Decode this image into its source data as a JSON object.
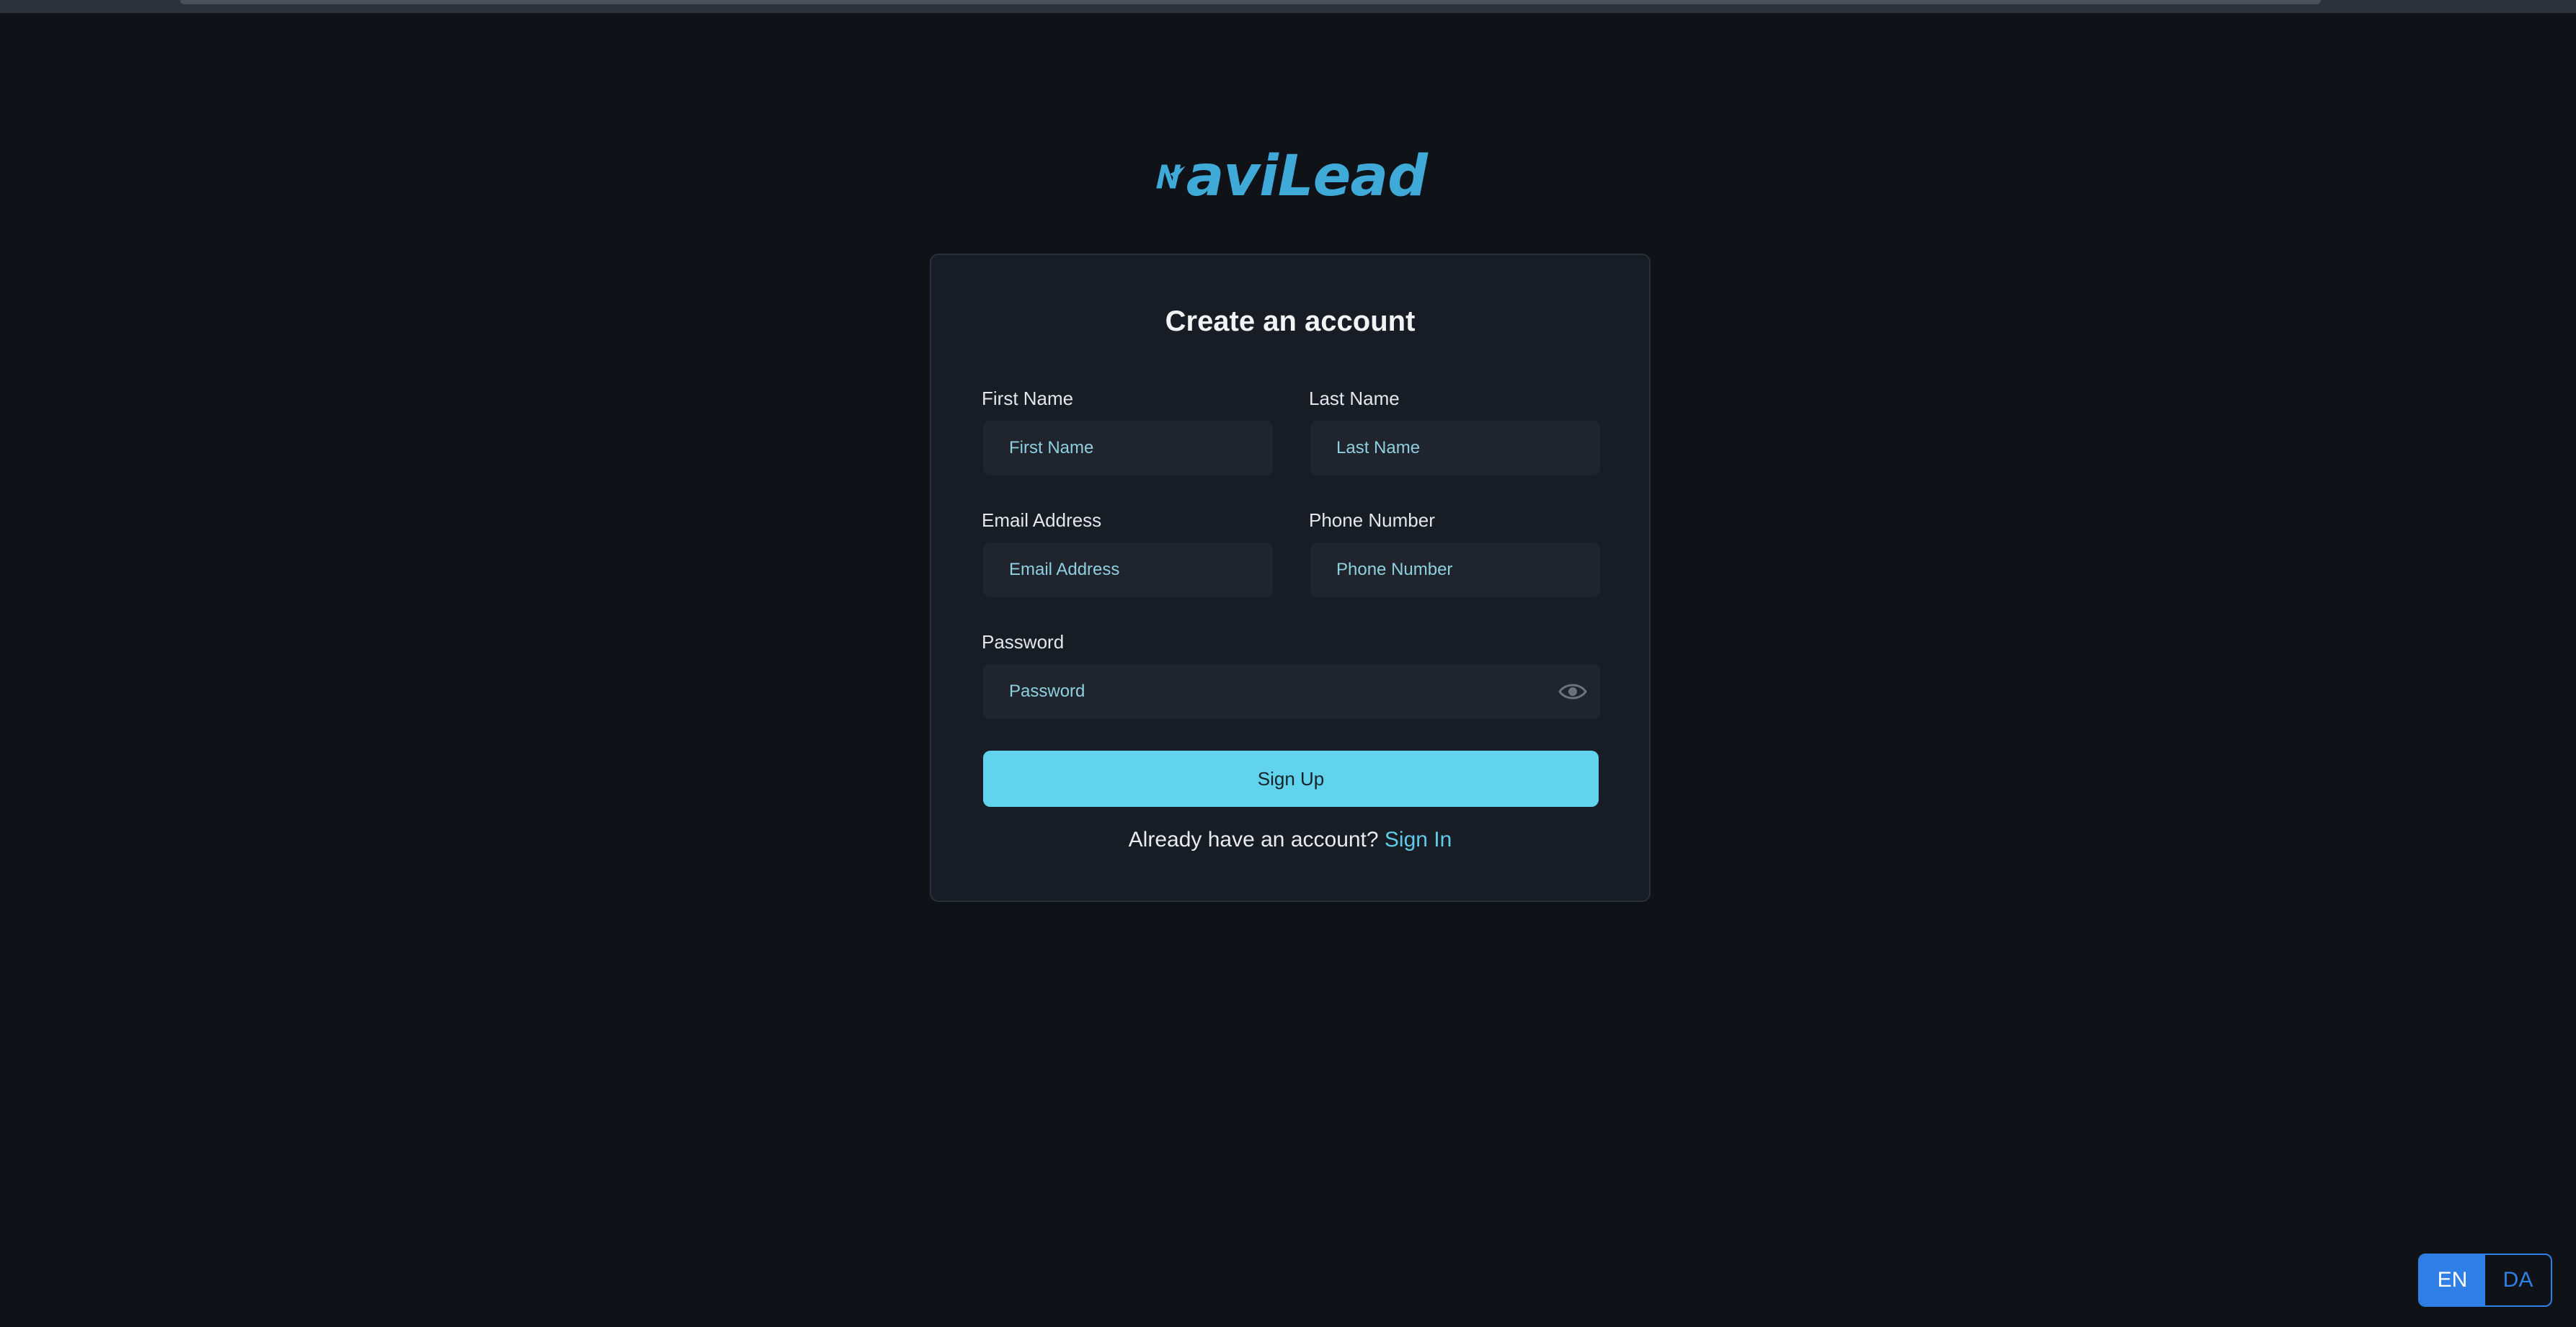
{
  "brand": {
    "logo_text": "aviLead",
    "logo_color": "#3fa9d8"
  },
  "form": {
    "title": "Create an account",
    "first_name": {
      "label": "First Name",
      "placeholder": "First Name"
    },
    "last_name": {
      "label": "Last Name",
      "placeholder": "Last Name"
    },
    "email": {
      "label": "Email Address",
      "placeholder": "Email Address"
    },
    "phone": {
      "label": "Phone Number",
      "placeholder": "Phone Number"
    },
    "password": {
      "label": "Password",
      "placeholder": "Password",
      "toggle_icon": "eye-icon"
    },
    "submit_label": "Sign Up",
    "signin_prompt": "Already have an account?",
    "signin_link": "Sign In"
  },
  "language": {
    "options": [
      "EN",
      "DA"
    ],
    "selected": "EN"
  },
  "colors": {
    "accent": "#62d3ed",
    "link": "#5fcbe6",
    "language_active": "#2f7fe6",
    "background": "#0f1217",
    "card": "#181d25"
  }
}
